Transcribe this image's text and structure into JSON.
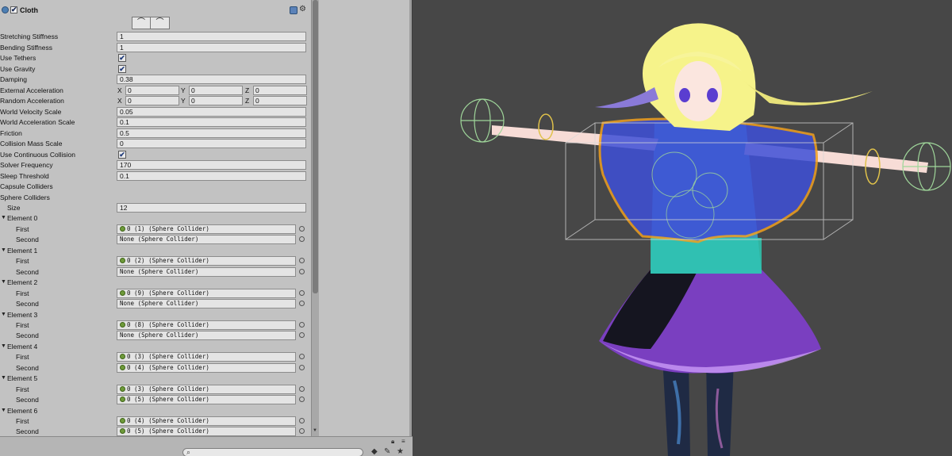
{
  "component": {
    "title": "Cloth",
    "enabled": true,
    "edit_buttons": [
      "⌒",
      "⌒"
    ]
  },
  "properties": [
    {
      "label": "Stretching Stiffness",
      "type": "float",
      "value": "1"
    },
    {
      "label": "Bending Stiffness",
      "type": "float",
      "value": "1"
    },
    {
      "label": "Use Tethers",
      "type": "bool",
      "value": "✔"
    },
    {
      "label": "Use Gravity",
      "type": "bool",
      "value": "✔"
    },
    {
      "label": "Damping",
      "type": "float",
      "value": "0.38"
    },
    {
      "label": "External Acceleration",
      "type": "vector",
      "x": "0",
      "y": "0",
      "z": "0"
    },
    {
      "label": "Random Acceleration",
      "type": "vector",
      "x": "0",
      "y": "0",
      "z": "0"
    },
    {
      "label": "World Velocity Scale",
      "type": "float",
      "value": "0.05"
    },
    {
      "label": "World Acceleration Scale",
      "type": "float",
      "value": "0.1"
    },
    {
      "label": "Friction",
      "type": "float",
      "value": "0.5"
    },
    {
      "label": "Collision Mass Scale",
      "type": "float",
      "value": "0"
    },
    {
      "label": "Use Continuous Collision",
      "type": "bool",
      "value": "✔"
    },
    {
      "label": "Solver Frequency",
      "type": "float",
      "value": "170"
    },
    {
      "label": "Sleep Threshold",
      "type": "float",
      "value": "0.1"
    },
    {
      "label": "Capsule Colliders",
      "type": "header"
    },
    {
      "label": "Sphere Colliders",
      "type": "header"
    }
  ],
  "axis_labels": {
    "x": "X",
    "y": "Y",
    "z": "Z"
  },
  "sphere_colliders": {
    "size_label": "Size",
    "size": "12",
    "first_label": "First",
    "second_label": "Second",
    "elements": [
      {
        "label": "Element 0",
        "first": "0 (1) (Sphere Collider)",
        "second": "None (Sphere Collider)"
      },
      {
        "label": "Element 1",
        "first": "0 (2) (Sphere Collider)",
        "second": "None (Sphere Collider)"
      },
      {
        "label": "Element 2",
        "first": "0 (9) (Sphere Collider)",
        "second": "None (Sphere Collider)"
      },
      {
        "label": "Element 3",
        "first": "0 (8) (Sphere Collider)",
        "second": "None (Sphere Collider)"
      },
      {
        "label": "Element 4",
        "first": "0 (3) (Sphere Collider)",
        "second": "0 (4) (Sphere Collider)"
      },
      {
        "label": "Element 5",
        "first": "0 (3) (Sphere Collider)",
        "second": "0 (5) (Sphere Collider)"
      },
      {
        "label": "Element 6",
        "first": "0 (4) (Sphere Collider)",
        "second": "0 (5) (Sphere Collider)"
      }
    ]
  },
  "colors": {
    "panel_bg": "#c2c2c2",
    "scene_bg": "#474747",
    "collider_green": "#9fd69a",
    "selection_orange": "#f0a020"
  },
  "icons": [
    "cloth-component-icon",
    "help-icon",
    "settings-gear-icon",
    "search-icon",
    "lock-icon",
    "panel-menu-icon",
    "tag-icon",
    "star-icon",
    "filter-icon"
  ]
}
